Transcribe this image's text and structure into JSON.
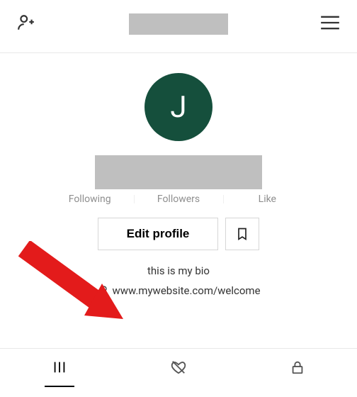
{
  "avatar_initial": "J",
  "stats": {
    "following_label": "Following",
    "followers_label": "Followers",
    "like_label": "Like"
  },
  "edit_profile_label": "Edit profile",
  "bio_text": "this is my bio",
  "website_url": "www.mywebsite.com/welcome",
  "colors": {
    "avatar_bg": "#154f3c",
    "redacted": "#bfbfbf",
    "annotation": "#e31b1b"
  }
}
